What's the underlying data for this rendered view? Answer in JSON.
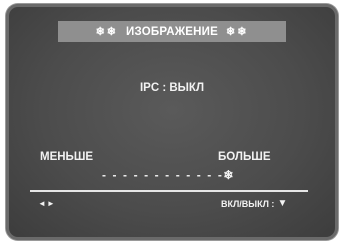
{
  "osd_menu": {
    "title": "ИЗОБРАЖЕНИЕ",
    "title_decoration": "❄❄",
    "ipc_setting": "IPC : ВЫКЛ",
    "less_label": "МЕНЬШЕ",
    "more_label": "БОЛЬШЕ",
    "level_bar": "- - - - - - - - - - - -❄",
    "nav_hint": "◄►",
    "toggle_hint": "ВКЛ/ВЫКЛ :",
    "toggle_icon": "▼"
  },
  "colors": {
    "background": "#4c4c4c",
    "title_bar": "#8f8f8f",
    "text": "#f2f2f2"
  }
}
